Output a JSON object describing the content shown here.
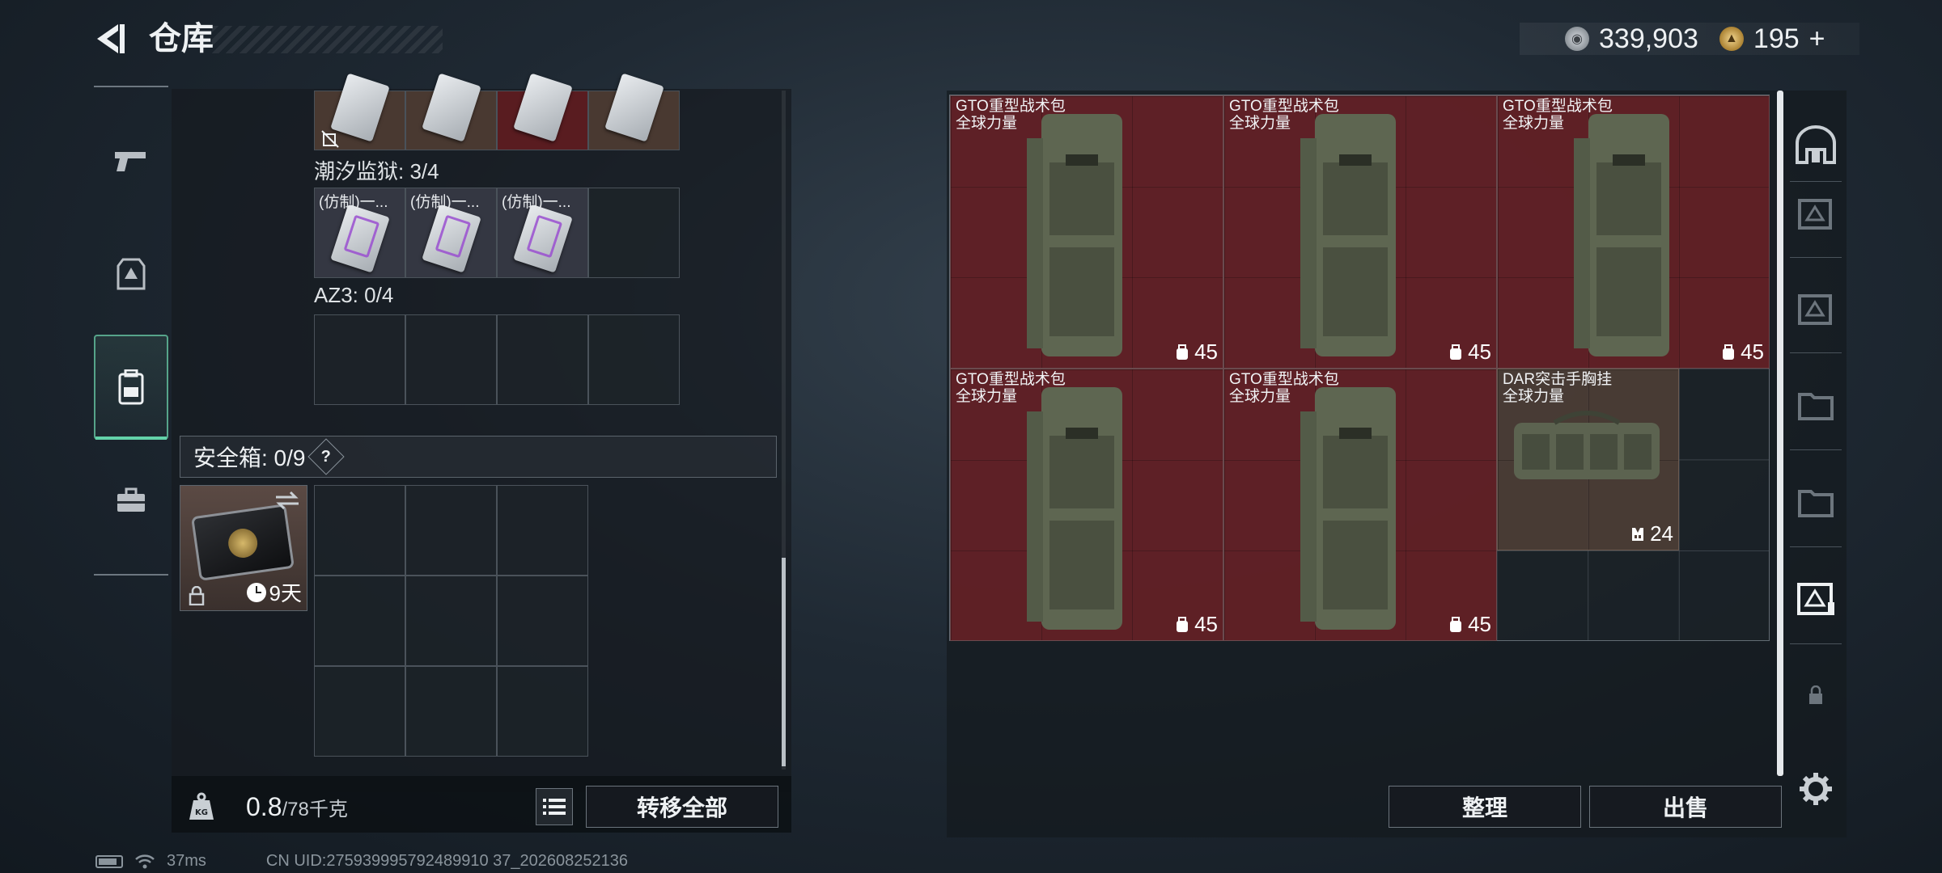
{
  "header": {
    "title": "仓库",
    "silver_amount": "339,903",
    "gold_amount": "195",
    "gold_plus": "+"
  },
  "left_rail": {
    "items": [
      {
        "icon": "pistol-icon"
      },
      {
        "icon": "armor-icon"
      },
      {
        "icon": "backpack-icon",
        "active": true
      },
      {
        "icon": "briefcase-icon"
      }
    ]
  },
  "inventory": {
    "sections": [
      {
        "label": "潮汐监狱: 3/4",
        "slots": [
          "(仿制)一...",
          "(仿制)一...",
          "(仿制)一...",
          ""
        ]
      },
      {
        "label": "AZ3: 0/4",
        "slots": [
          "",
          "",
          "",
          ""
        ]
      }
    ],
    "safe_box": {
      "label": "安全箱: 0/9",
      "help": "?",
      "timer": "9天"
    }
  },
  "footer": {
    "weight_value": "0.8",
    "weight_max": "/78千克",
    "kg_badge": "KG",
    "transfer_all": "转移全部",
    "organize": "整理",
    "sell": "出售"
  },
  "stash": {
    "items": [
      {
        "name": "GTO重型战术包",
        "faction": "全球力量",
        "stat": "45",
        "stat_icon": "capacity-icon"
      },
      {
        "name": "GTO重型战术包",
        "faction": "全球力量",
        "stat": "45",
        "stat_icon": "capacity-icon"
      },
      {
        "name": "GTO重型战术包",
        "faction": "全球力量",
        "stat": "45",
        "stat_icon": "capacity-icon"
      },
      {
        "name": "GTO重型战术包",
        "faction": "全球力量",
        "stat": "45",
        "stat_icon": "capacity-icon"
      },
      {
        "name": "GTO重型战术包",
        "faction": "全球力量",
        "stat": "45",
        "stat_icon": "capacity-icon"
      },
      {
        "name": "DAR突击手胸挂",
        "faction": "全球力量",
        "stat": "24",
        "stat_icon": "chest-rig-icon"
      }
    ]
  },
  "status_bar": {
    "ping": "37ms",
    "uid": "CN UID:275939995792489910 37_202608252136"
  },
  "colors": {
    "accent": "#63d2a9",
    "item_highlight": "#682026",
    "panel": "#161b20"
  }
}
